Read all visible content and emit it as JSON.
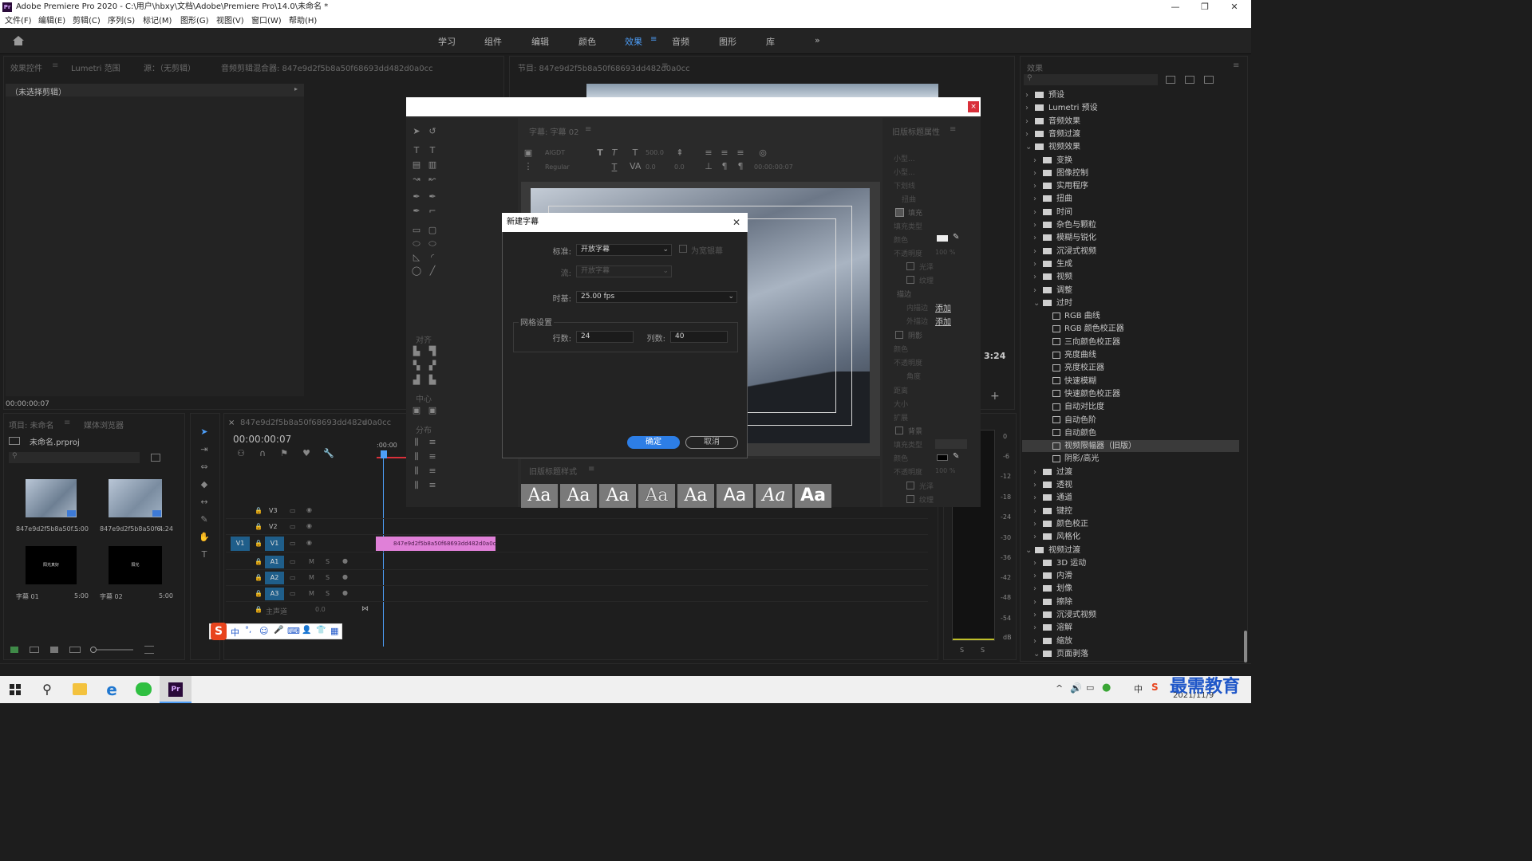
{
  "window": {
    "title": "Adobe Premiere Pro 2020 - C:\\用户\\hbxy\\文档\\Adobe\\Premiere Pro\\14.0\\未命名 *",
    "min": "—",
    "max": "❐",
    "close": "✕"
  },
  "menus": [
    "文件(F)",
    "编辑(E)",
    "剪辑(C)",
    "序列(S)",
    "标记(M)",
    "图形(G)",
    "视图(V)",
    "窗口(W)",
    "帮助(H)"
  ],
  "workspaces": [
    "学习",
    "组件",
    "编辑",
    "颜色",
    "效果",
    "音频",
    "图形",
    "库"
  ],
  "workspace_more": "»",
  "source_panel": {
    "tabs": [
      "效果控件",
      "Lumetri 范围",
      "源：（无剪辑）",
      "音频剪辑混合器: 847e9d2f5b8a50f68693dd482d0a0cc"
    ],
    "clip_header": "（未选择剪辑）",
    "timecode": "00:00:00:07"
  },
  "program_panel": {
    "tab": "节目: 847e9d2f5b8a50f68693dd482d0a0cc",
    "timecode_right": "3:24"
  },
  "project_panel": {
    "tabs": [
      "项目: 未命名",
      "媒体浏览器"
    ],
    "file": "未命名.prproj",
    "items": [
      {
        "name": "847e9d2f5b8a50f...",
        "dur": "5:00"
      },
      {
        "name": "847e9d2f5b8a50f6...",
        "dur": "4:24"
      },
      {
        "name": "字幕 01",
        "dur": "5:00",
        "thumb": "阳光真好"
      },
      {
        "name": "字幕 02",
        "dur": "5:00",
        "thumb": "阳光"
      }
    ]
  },
  "timeline": {
    "tab": "847e9d2f5b8a50f68693dd482d0a0cc",
    "timecode": "00:00:00:07",
    "ruler": ":00:00",
    "tracks": [
      "V3",
      "V2",
      "V1",
      "A1",
      "A2",
      "A3"
    ],
    "master": "主声道",
    "master_val": "0.0",
    "clip": "847e9d2f5b8a50f68693dd482d0a0cc.j",
    "src_v": "V1"
  },
  "effects_panel": {
    "title": "效果",
    "items": [
      {
        "t": "预设",
        "lvl": 0,
        "type": "preset"
      },
      {
        "t": "Lumetri 预设",
        "lvl": 0,
        "type": "preset"
      },
      {
        "t": "音频效果",
        "lvl": 0,
        "type": "folder"
      },
      {
        "t": "音频过渡",
        "lvl": 0,
        "type": "folder"
      },
      {
        "t": "视频效果",
        "lvl": 0,
        "type": "folder",
        "open": true
      },
      {
        "t": "变换",
        "lvl": 1,
        "type": "folder"
      },
      {
        "t": "图像控制",
        "lvl": 1,
        "type": "folder"
      },
      {
        "t": "实用程序",
        "lvl": 1,
        "type": "folder"
      },
      {
        "t": "扭曲",
        "lvl": 1,
        "type": "folder"
      },
      {
        "t": "时间",
        "lvl": 1,
        "type": "folder"
      },
      {
        "t": "杂色与颗粒",
        "lvl": 1,
        "type": "folder"
      },
      {
        "t": "模糊与锐化",
        "lvl": 1,
        "type": "folder"
      },
      {
        "t": "沉浸式视频",
        "lvl": 1,
        "type": "folder"
      },
      {
        "t": "生成",
        "lvl": 1,
        "type": "folder"
      },
      {
        "t": "视频",
        "lvl": 1,
        "type": "folder"
      },
      {
        "t": "调整",
        "lvl": 1,
        "type": "folder"
      },
      {
        "t": "过时",
        "lvl": 1,
        "type": "folder",
        "open": true
      },
      {
        "t": "RGB 曲线",
        "lvl": 2,
        "type": "fx"
      },
      {
        "t": "RGB 颜色校正器",
        "lvl": 2,
        "type": "fx"
      },
      {
        "t": "三向颜色校正器",
        "lvl": 2,
        "type": "fx"
      },
      {
        "t": "亮度曲线",
        "lvl": 2,
        "type": "fx"
      },
      {
        "t": "亮度校正器",
        "lvl": 2,
        "type": "fx"
      },
      {
        "t": "快速模糊",
        "lvl": 2,
        "type": "fx"
      },
      {
        "t": "快速颜色校正器",
        "lvl": 2,
        "type": "fx"
      },
      {
        "t": "自动对比度",
        "lvl": 2,
        "type": "fx"
      },
      {
        "t": "自动色阶",
        "lvl": 2,
        "type": "fx"
      },
      {
        "t": "自动颜色",
        "lvl": 2,
        "type": "fx"
      },
      {
        "t": "视频限幅器（旧版）",
        "lvl": 2,
        "type": "fx",
        "sel": true
      },
      {
        "t": "阴影/高光",
        "lvl": 2,
        "type": "fx"
      },
      {
        "t": "过渡",
        "lvl": 1,
        "type": "folder"
      },
      {
        "t": "透视",
        "lvl": 1,
        "type": "folder"
      },
      {
        "t": "通道",
        "lvl": 1,
        "type": "folder"
      },
      {
        "t": "键控",
        "lvl": 1,
        "type": "folder"
      },
      {
        "t": "颜色校正",
        "lvl": 1,
        "type": "folder"
      },
      {
        "t": "风格化",
        "lvl": 1,
        "type": "folder"
      },
      {
        "t": "视频过渡",
        "lvl": 0,
        "type": "folder",
        "open": true
      },
      {
        "t": "3D 运动",
        "lvl": 1,
        "type": "folder"
      },
      {
        "t": "内滑",
        "lvl": 1,
        "type": "folder"
      },
      {
        "t": "划像",
        "lvl": 1,
        "type": "folder"
      },
      {
        "t": "擦除",
        "lvl": 1,
        "type": "folder"
      },
      {
        "t": "沉浸式视频",
        "lvl": 1,
        "type": "folder"
      },
      {
        "t": "溶解",
        "lvl": 1,
        "type": "folder"
      },
      {
        "t": "缩放",
        "lvl": 1,
        "type": "folder"
      },
      {
        "t": "页面剥落",
        "lvl": 1,
        "type": "folder",
        "open": true
      }
    ]
  },
  "legacy_title": {
    "panel": "字幕: 字幕 02",
    "font": "AIGDT",
    "style": "Regular",
    "size": "500.0",
    "kern": "0.0",
    "lead": "0.0",
    "tc": "00:00:00:07",
    "props_title": "旧版标题属性",
    "props": [
      "小型...",
      "小型...",
      "下划线",
      "扭曲",
      "填充",
      "填充类型",
      "颜色",
      "不透明度",
      "光泽",
      "纹理",
      "描边",
      "内描边",
      "外描边",
      "阴影",
      "颜色",
      "不透明度",
      "角度",
      "距离",
      "大小",
      "扩展",
      "背景",
      "填充类型",
      "颜色",
      "不透明度",
      "光泽",
      "纹理"
    ],
    "add": "添加",
    "opacity_val": "100 %",
    "align_hdr": "对齐",
    "center_hdr": "中心",
    "distribute_hdr": "分布",
    "styles_title": "旧版标题样式",
    "style_sample": "Aa"
  },
  "dialog": {
    "title": "新建字幕",
    "close": "✕",
    "standard_label": "标准:",
    "standard": "开放字幕",
    "stream_label": "流:",
    "stream": "开放字幕",
    "checkbox": "为宽银幕",
    "timebase_label": "时基:",
    "timebase": "25.00 fps",
    "grid_title": "网格设置",
    "rows_label": "行数:",
    "rows": "24",
    "cols_label": "列数:",
    "cols": "40",
    "ok": "确定",
    "cancel": "取消"
  },
  "meter": {
    "labels": [
      "0",
      "-6",
      "-12",
      "-18",
      "-24",
      "-30",
      "-36",
      "-42",
      "-48",
      "-54",
      "dB"
    ],
    "btn_s1": "S",
    "btn_s2": "S"
  },
  "ime": {
    "logo": "S",
    "items": [
      "中",
      "°,",
      "☺",
      "🎤",
      "⌨",
      "👤",
      "👕",
      "▦"
    ]
  },
  "taskbar": {
    "date": "2021/11/9",
    "tray": [
      "^",
      "🔊",
      "▭",
      "●",
      "中",
      "S"
    ]
  },
  "watermark": "最需教育"
}
